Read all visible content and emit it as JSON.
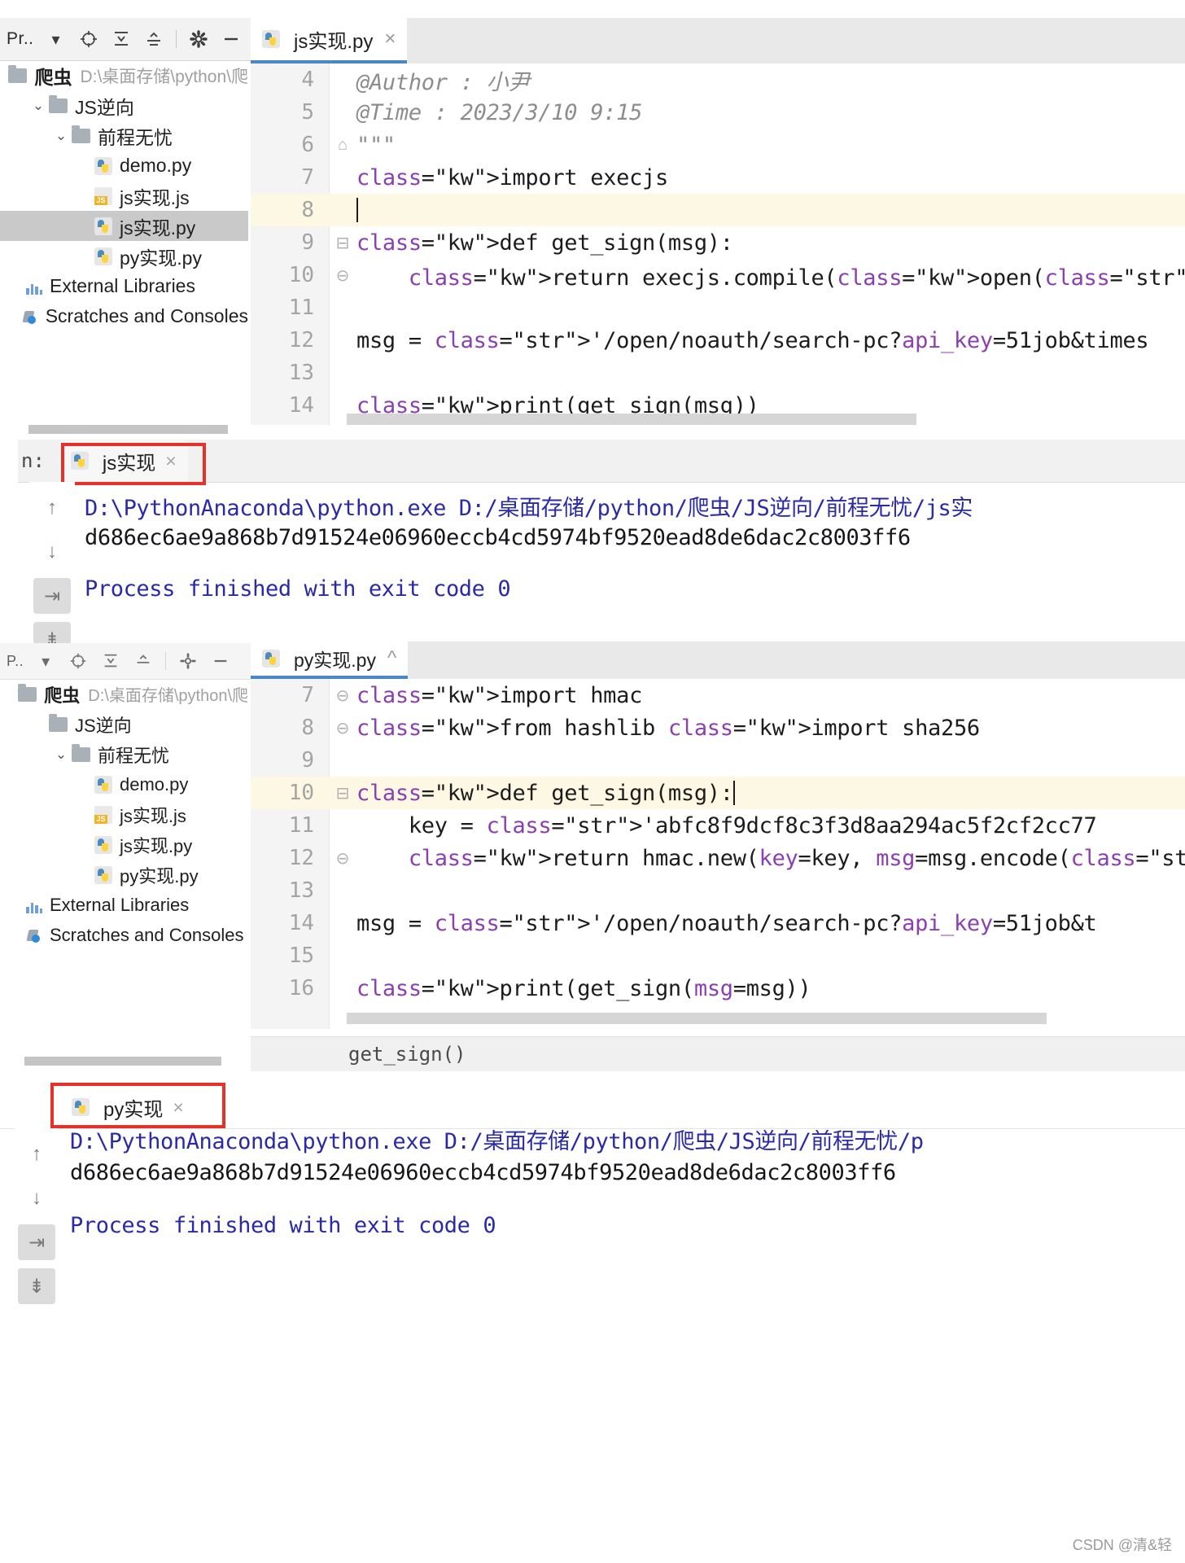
{
  "top_panel": {
    "toolbar": {
      "title": "Pr..",
      "icons": [
        "dropdown-arrow-icon",
        "locate-target-icon",
        "collapse-all-icon",
        "expand-all-icon",
        "settings-gear-icon",
        "minimize-icon"
      ]
    },
    "tree": {
      "items": [
        {
          "label": "爬虫",
          "path": "D:\\桌面存储\\python\\爬",
          "icon": "folder-icon",
          "twist": "",
          "indent": 0,
          "selected": false,
          "bold": true
        },
        {
          "label": "JS逆向",
          "path": "",
          "icon": "folder-icon",
          "twist": "⌄",
          "indent": 1,
          "selected": false,
          "bold": false
        },
        {
          "label": "前程无忧",
          "path": "",
          "icon": "folder-icon",
          "twist": "⌄",
          "indent": 2,
          "selected": false,
          "bold": false
        },
        {
          "label": "demo.py",
          "path": "",
          "icon": "python-file-icon",
          "twist": "",
          "indent": 3,
          "selected": false,
          "bold": false
        },
        {
          "label": "js实现.js",
          "path": "",
          "icon": "js-file-icon",
          "twist": "",
          "indent": 3,
          "selected": false,
          "bold": false
        },
        {
          "label": "js实现.py",
          "path": "",
          "icon": "python-file-icon",
          "twist": "",
          "indent": 3,
          "selected": true,
          "bold": false
        },
        {
          "label": "py实现.py",
          "path": "",
          "icon": "python-file-icon",
          "twist": "",
          "indent": 3,
          "selected": false,
          "bold": false
        },
        {
          "label": "External Libraries",
          "path": "",
          "icon": "libraries-icon",
          "twist": "",
          "indent": 0,
          "selected": false,
          "bold": false
        },
        {
          "label": "Scratches and Consoles",
          "path": "",
          "icon": "scratches-icon",
          "twist": "",
          "indent": 0,
          "selected": false,
          "bold": false
        }
      ]
    },
    "editor": {
      "tab_label": "js实现.py",
      "tab_close": "×",
      "lines": [
        {
          "no": "4",
          "fold": "",
          "highlight": false,
          "text": "@Author : 小尹",
          "style": "comment"
        },
        {
          "no": "5",
          "fold": "",
          "highlight": false,
          "text": "@Time : 2023/3/10 9:15",
          "style": "comment"
        },
        {
          "no": "6",
          "fold": "⌂",
          "highlight": false,
          "text": "\"\"\"",
          "style": "comment"
        },
        {
          "no": "7",
          "fold": "",
          "highlight": false,
          "text": "import execjs",
          "style": "code"
        },
        {
          "no": "8",
          "fold": "",
          "highlight": true,
          "text": "",
          "style": "code"
        },
        {
          "no": "9",
          "fold": "⊟",
          "highlight": false,
          "text": "def get_sign(msg):",
          "style": "code"
        },
        {
          "no": "10",
          "fold": "⊖",
          "highlight": false,
          "text": "    return execjs.compile(open('./js实现.js', mod",
          "style": "code"
        },
        {
          "no": "11",
          "fold": "",
          "highlight": false,
          "text": "",
          "style": "code"
        },
        {
          "no": "12",
          "fold": "",
          "highlight": false,
          "text": "msg = '/open/noauth/search-pc?api_key=51job&times",
          "style": "code"
        },
        {
          "no": "13",
          "fold": "",
          "highlight": false,
          "text": "",
          "style": "code"
        },
        {
          "no": "14",
          "fold": "",
          "highlight": false,
          "text": "print(get_sign(msg))",
          "style": "code"
        }
      ]
    }
  },
  "top_console": {
    "label_prefix": "n:",
    "tab_label": "js实现",
    "tab_close": "×",
    "lines": [
      "D:\\PythonAnaconda\\python.exe D:/桌面存储/python/爬虫/JS逆向/前程无忧/js实",
      "d686ec6ae9a868b7d91524e06960eccb4cd5974bf9520ead8de6dac2c8003ff6",
      "",
      "Process finished with exit code 0"
    ],
    "side_buttons": [
      "scroll-up-icon",
      "scroll-down-icon",
      "soft-wrap-icon",
      "scroll-to-end-icon",
      "print-icon"
    ]
  },
  "bottom_panel": {
    "toolbar": {
      "title": "P..",
      "icons": [
        "dropdown-arrow-icon",
        "locate-target-icon",
        "collapse-all-icon",
        "expand-all-icon",
        "settings-gear-icon",
        "minimize-icon"
      ]
    },
    "tree": {
      "items": [
        {
          "label": "爬虫",
          "path": "D:\\桌面存储\\python\\爬",
          "icon": "folder-icon",
          "twist": "",
          "indent": 0,
          "selected": false,
          "bold": true
        },
        {
          "label": "JS逆向",
          "path": "",
          "icon": "folder-icon",
          "twist": "",
          "indent": 1,
          "selected": false,
          "bold": false
        },
        {
          "label": "前程无忧",
          "path": "",
          "icon": "folder-icon",
          "twist": "⌄",
          "indent": 2,
          "selected": false,
          "bold": false
        },
        {
          "label": "demo.py",
          "path": "",
          "icon": "python-file-icon",
          "twist": "",
          "indent": 3,
          "selected": false,
          "bold": false
        },
        {
          "label": "js实现.js",
          "path": "",
          "icon": "js-file-icon",
          "twist": "",
          "indent": 3,
          "selected": false,
          "bold": false
        },
        {
          "label": "js实现.py",
          "path": "",
          "icon": "python-file-icon",
          "twist": "",
          "indent": 3,
          "selected": false,
          "bold": false
        },
        {
          "label": "py实现.py",
          "path": "",
          "icon": "python-file-icon",
          "twist": "",
          "indent": 3,
          "selected": false,
          "bold": false
        },
        {
          "label": "External Libraries",
          "path": "",
          "icon": "libraries-icon",
          "twist": "",
          "indent": 0,
          "selected": false,
          "bold": false
        },
        {
          "label": "Scratches and Consoles",
          "path": "",
          "icon": "scratches-icon",
          "twist": "",
          "indent": 0,
          "selected": false,
          "bold": false
        }
      ]
    },
    "editor": {
      "tab_label": "py实现.py",
      "tab_close": "^",
      "lines": [
        {
          "no": "7",
          "fold": "⊖",
          "highlight": false,
          "text": "import hmac",
          "style": "code"
        },
        {
          "no": "8",
          "fold": "⊖",
          "highlight": false,
          "text": "from hashlib import sha256",
          "style": "code"
        },
        {
          "no": "9",
          "fold": "",
          "highlight": false,
          "text": "",
          "style": "code"
        },
        {
          "no": "10",
          "fold": "⊟",
          "highlight": true,
          "text": "def get_sign(msg):",
          "style": "code"
        },
        {
          "no": "11",
          "fold": "",
          "highlight": false,
          "text": "    key = 'abfc8f9dcf8c3f3d8aa294ac5f2cf2cc77",
          "style": "code"
        },
        {
          "no": "12",
          "fold": "⊖",
          "highlight": false,
          "text": "    return hmac.new(key=key, msg=msg.encode('",
          "style": "code"
        },
        {
          "no": "13",
          "fold": "",
          "highlight": false,
          "text": "",
          "style": "code"
        },
        {
          "no": "14",
          "fold": "",
          "highlight": false,
          "text": "msg = '/open/noauth/search-pc?api_key=51job&t",
          "style": "code"
        },
        {
          "no": "15",
          "fold": "",
          "highlight": false,
          "text": "",
          "style": "code"
        },
        {
          "no": "16",
          "fold": "",
          "highlight": false,
          "text": "print(get_sign(msg=msg))",
          "style": "code"
        }
      ],
      "breadcrumb": "get_sign()"
    }
  },
  "bottom_console": {
    "tab_label": "py实现",
    "tab_close": "×",
    "lines": [
      "D:\\PythonAnaconda\\python.exe D:/桌面存储/python/爬虫/JS逆向/前程无忧/p",
      "d686ec6ae9a868b7d91524e06960eccb4cd5974bf9520ead8de6dac2c8003ff6",
      "",
      "Process finished with exit code 0"
    ],
    "side_buttons": [
      "scroll-up-icon",
      "scroll-down-icon",
      "soft-wrap-icon",
      "scroll-to-end-icon"
    ]
  },
  "watermark": "CSDN @清&轻",
  "colors": {
    "accent_blue": "#4a86c8",
    "highlight_yellow": "#fdf8e3",
    "selection_gray": "#c9c9c9",
    "red_box": "#e8302a",
    "string_teal": "#2e8b80",
    "keyword_blue": "#2f2fbf"
  }
}
